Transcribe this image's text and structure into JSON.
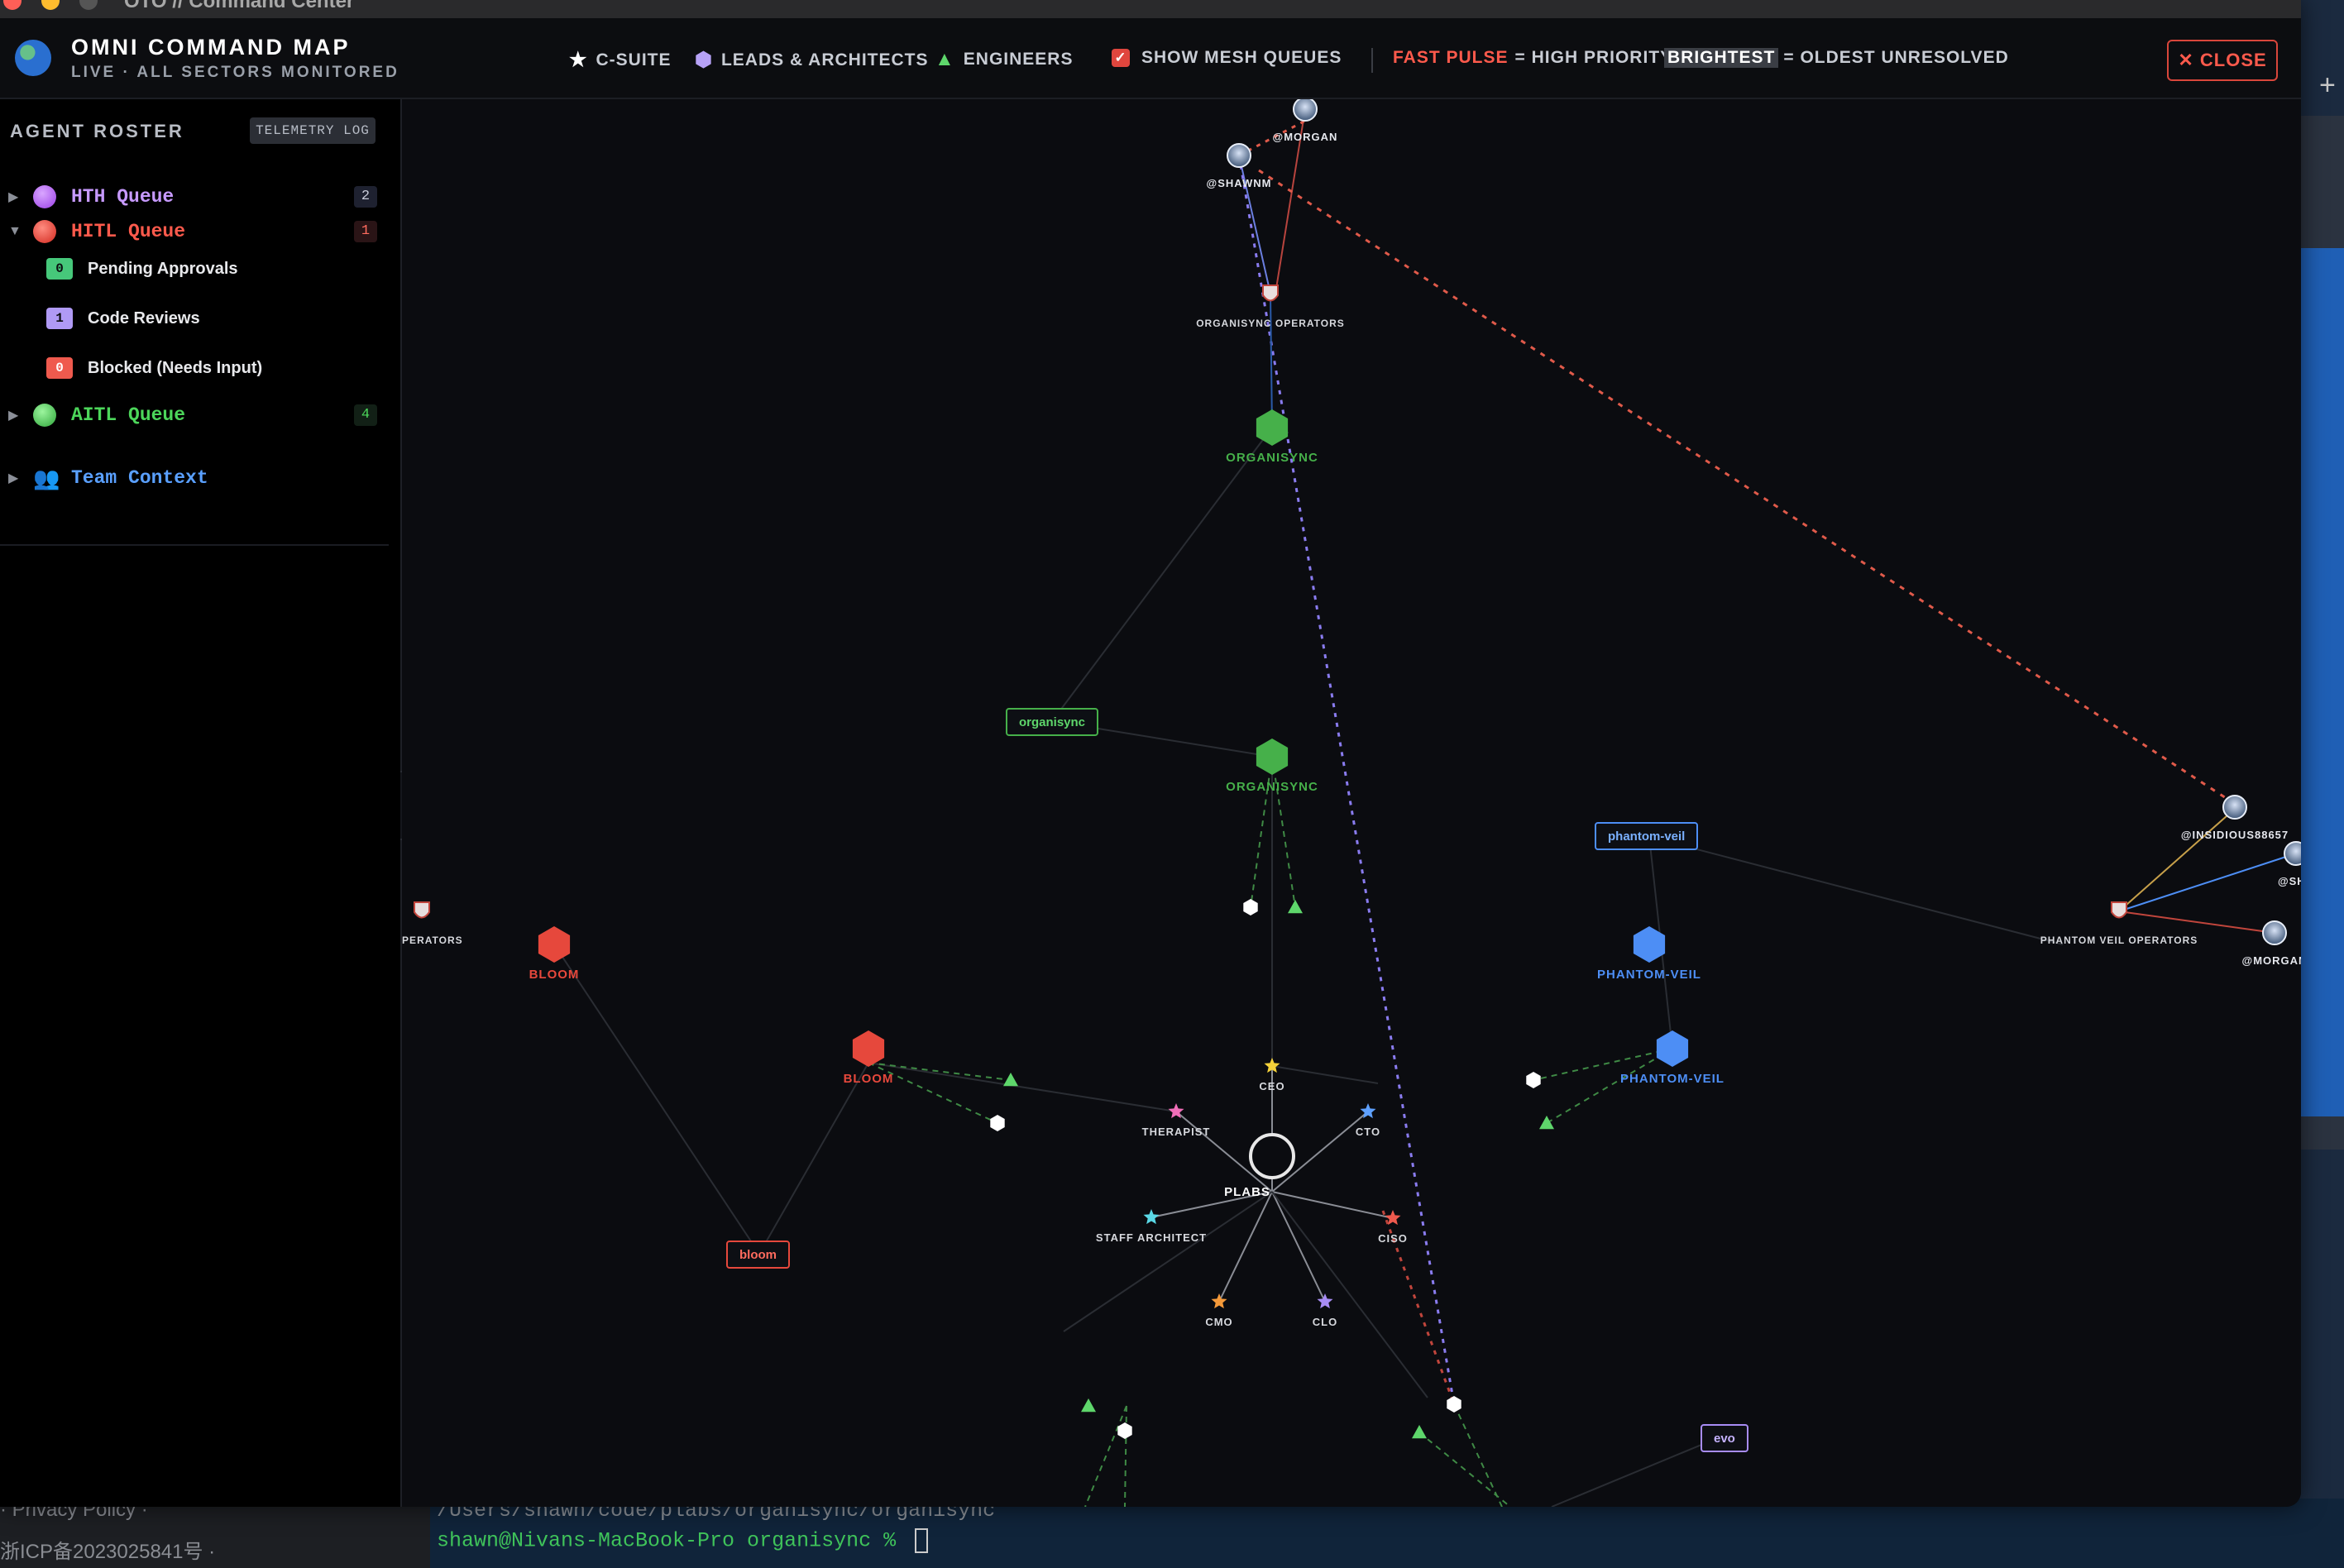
{
  "window": {
    "title": "OTO // Command Center"
  },
  "header": {
    "title": "OMNI COMMAND MAP",
    "subtitle": "LIVE · ALL SECTORS MONITORED",
    "legend": {
      "csuite": "C-SUITE",
      "leads": "LEADS & ARCHITECTS",
      "engineers": "ENGINEERS",
      "show_mesh": "SHOW MESH QUEUES",
      "fast_pulse": "FAST PULSE",
      "fast_pulse_desc": "= HIGH PRIORITY",
      "brightest": "BRIGHTEST",
      "brightest_desc": "= OLDEST UNRESOLVED"
    },
    "show_mesh_checked": true,
    "close_label": "✕ CLOSE"
  },
  "sidebar": {
    "title": "AGENT ROSTER",
    "telemetry_label": "TELEMETRY LOG",
    "queues": [
      {
        "label": "HTH Queue",
        "count": "2",
        "color": "#b86df5",
        "expanded": false
      },
      {
        "label": "HITL Queue",
        "count": "1",
        "color": "#e6483c",
        "expanded": true,
        "items": [
          {
            "badge": "0",
            "label": "Pending Approvals",
            "badge_color": "#46c87a"
          },
          {
            "badge": "1",
            "label": "Code Reviews",
            "badge_color": "#b09af5"
          },
          {
            "badge": "0",
            "label": "Blocked (Needs Input)",
            "badge_color": "#ef5a4e"
          }
        ]
      },
      {
        "label": "AITL Queue",
        "count": "4",
        "color": "#46c04a",
        "expanded": false
      }
    ],
    "team_context": "Team Context",
    "collapse_icon": "‹"
  },
  "map": {
    "center": {
      "label": "PLABS"
    },
    "csuite": [
      {
        "label": "CEO",
        "color": "#f5d23a"
      },
      {
        "label": "CTO",
        "color": "#5ea0ff"
      },
      {
        "label": "CISO",
        "color": "#ef5a4e"
      },
      {
        "label": "CLO",
        "color": "#a88cf5"
      },
      {
        "label": "CMO",
        "color": "#f59a3a"
      },
      {
        "label": "STAFF ARCHITECT",
        "color": "#5ad8e6"
      },
      {
        "label": "THERAPIST",
        "color": "#f06eb8"
      }
    ],
    "sectors": [
      {
        "label": "ORGANISYNC",
        "color": "#46b04a"
      },
      {
        "label": "ORGANISYNC",
        "color": "#46b04a"
      },
      {
        "label": "BLOOM",
        "color": "#e6483c"
      },
      {
        "label": "BLOOM",
        "color": "#e6483c"
      },
      {
        "label": "PHANTOM-VEIL",
        "color": "#4d8ef5"
      },
      {
        "label": "PHANTOM-VEIL",
        "color": "#4d8ef5"
      }
    ],
    "project_boxes": [
      {
        "label": "organisync",
        "color": "#46b04a"
      },
      {
        "label": "bloom",
        "color": "#e6483c"
      },
      {
        "label": "phantom-veil",
        "color": "#4d8ef5"
      },
      {
        "label": "evo",
        "color": "#a88cf5"
      }
    ],
    "operators": [
      {
        "label": "ORGANISYNC OPERATORS"
      },
      {
        "label": "PHANTOM VEIL OPERATORS"
      },
      {
        "label": "M OPERATORS"
      }
    ],
    "users": [
      {
        "label": "@MORGAN"
      },
      {
        "label": "@SHAWNM"
      },
      {
        "label": "@INSIDIOUS88657"
      },
      {
        "label": "@SHA"
      },
      {
        "label": "@MORGAN"
      }
    ]
  },
  "desktop": {
    "footer_line1": "· Privacy Policy ·",
    "footer_line2": "浙ICP备2023025841号 ·",
    "terminal_line1": "/Users/shawn/code/plabs/organisync/organisync",
    "terminal_line2": "shawn@Nivans-MacBook-Pro organisync % "
  }
}
